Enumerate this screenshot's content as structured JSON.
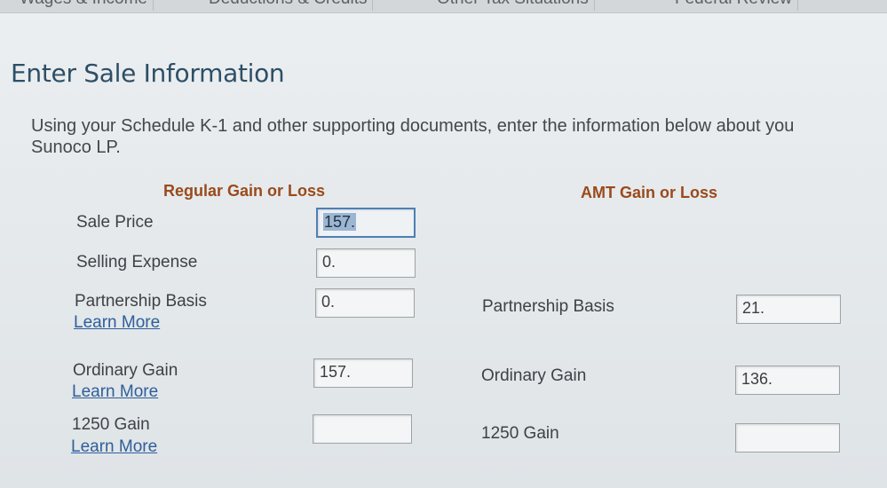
{
  "nav": {
    "tabs": [
      "Wages & Income",
      "Deductions & Credits",
      "Other Tax Situations",
      "Federal Review"
    ]
  },
  "page": {
    "title": "Enter Sale Information",
    "intro_line1": "Using your Schedule K-1 and other supporting documents, enter the information below about you",
    "intro_line2": "Sunoco LP."
  },
  "regular": {
    "header": "Regular Gain or Loss",
    "sale_price": {
      "label": "Sale Price",
      "value": "157."
    },
    "selling_expense": {
      "label": "Selling Expense",
      "value": "0."
    },
    "partnership_basis": {
      "label": "Partnership Basis",
      "value": "0.",
      "link": "Learn More"
    },
    "ordinary_gain": {
      "label": "Ordinary Gain",
      "value": "157.",
      "link": "Learn More"
    },
    "gain_1250": {
      "label": "1250 Gain",
      "value": "",
      "link": "Learn More"
    }
  },
  "amt": {
    "header": "AMT Gain or Loss",
    "partnership_basis": {
      "label": "Partnership Basis",
      "value": "21."
    },
    "ordinary_gain": {
      "label": "Ordinary Gain",
      "value": "136."
    },
    "gain_1250": {
      "label": "1250 Gain",
      "value": ""
    }
  }
}
